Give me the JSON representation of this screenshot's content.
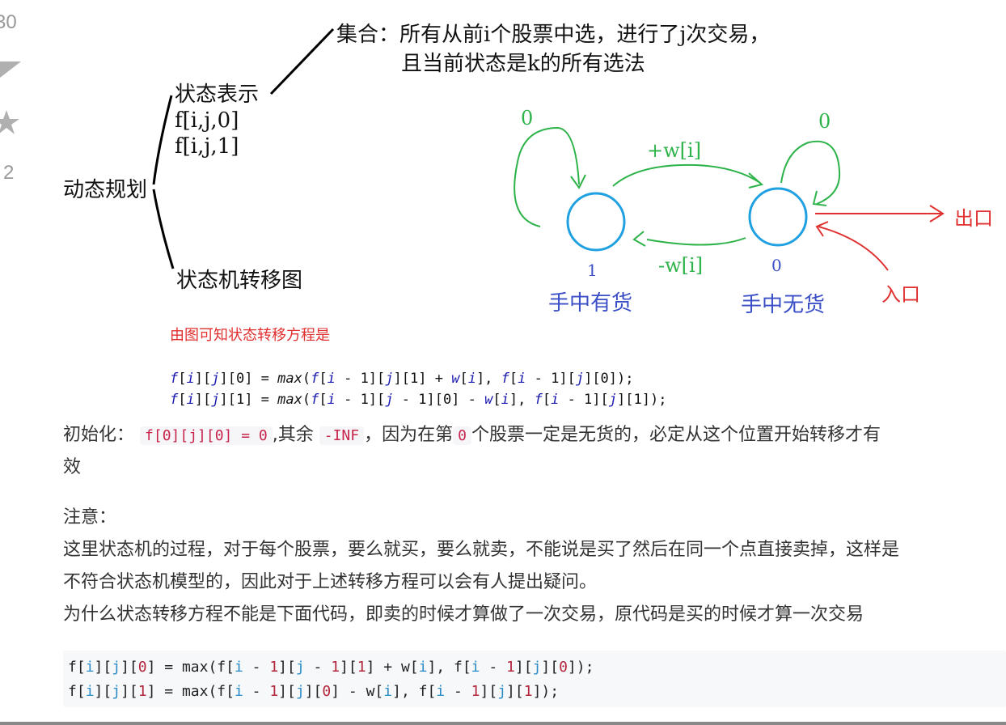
{
  "vote_panel": {
    "count_top": "30",
    "count_bottom": "2"
  },
  "diagram": {
    "set_label": "集合：所有从前i个股票中选，进行了j次交易，",
    "set_label_2": "且当前状态是k的所有选法",
    "state_repr": "状态表示",
    "state_f0": "f[i,j,0]",
    "state_f1": "f[i,j,1]",
    "dp": "动态规划",
    "state_machine": "状态机转移图",
    "loop_left": "0",
    "loop_right": "0",
    "edge_top": "+w[i]",
    "edge_bottom": "-w[i]",
    "node_left_num": "1",
    "node_right_num": "0",
    "node_left_label": "手中有货",
    "node_right_label": "手中无货",
    "exit": "出口",
    "entry": "入口",
    "conclusion": "由图可知状态转移方程是",
    "colors": {
      "green": "#2db34a",
      "blue": "#3a4fc7",
      "red": "#e03030",
      "circle": "#1fa0e0"
    }
  },
  "equations": {
    "line1": {
      "f": "f",
      "a": "[",
      "i": "i",
      "b": "][",
      "j": "j",
      "c": "][0] = ",
      "max": "max",
      "d": "(",
      "f2": "f",
      "e": "[",
      "i2": "i",
      "g": " - 1][",
      "j2": "j",
      "h": "][1] + ",
      "w": "w",
      "k": "[",
      "i3": "i",
      "l": "], ",
      "f3": "f",
      "m": "[",
      "i4": "i",
      "n": " - 1][",
      "j3": "j",
      "o": "][0]);"
    },
    "line2": {
      "f": "f",
      "a": "[",
      "i": "i",
      "b": "][",
      "j": "j",
      "c": "][1] = ",
      "max": "max",
      "d": "(",
      "f2": "f",
      "e": "[",
      "i2": "i",
      "g": " - 1][",
      "j2": "j",
      "h": " - 1][0] - ",
      "w": "w",
      "k": "[",
      "i3": "i",
      "l": "], ",
      "f3": "f",
      "m": "[",
      "i4": "i",
      "n": " - 1][",
      "j3": "j",
      "o": "][1]);"
    }
  },
  "article": {
    "init_prefix": "初始化：",
    "init_code": "f[0][j][0] = 0",
    "init_mid": ",其余",
    "init_inf": "-INF",
    "init_text": "，因为在第",
    "init_zero": "0",
    "init_rest": "个股票一定是无货的，必定从这个位置开始转移才有",
    "init_wrap": "效",
    "note_title": "注意：",
    "note_l1": "这里状态机的过程，对于每个股票，要么就买，要么就卖，不能说是买了然后在同一个点直接卖掉，这样是",
    "note_l2": "不符合状态机模型的，因此对于上述转移方程可以会有人提出疑问。",
    "note_l3": "为什么状态转移方程不能是下面代码，即卖的时候才算做了一次交易，原代码是买的时候才算一次交易"
  },
  "codeblock": {
    "line1": [
      "f[",
      "i",
      "][",
      "j",
      "][",
      "0",
      "] = max(f[",
      "i",
      " - ",
      "1",
      "][",
      "j",
      " - ",
      "1",
      "][",
      "1",
      "] + w[",
      "i",
      "], f[",
      "i",
      " - ",
      "1",
      "][",
      "j",
      "][",
      "0",
      "]);"
    ],
    "line2": [
      "f[",
      "i",
      "][",
      "j",
      "][",
      "1",
      "] = max(f[",
      "i",
      " - ",
      "1",
      "][",
      "j",
      "][",
      "0",
      "] - w[",
      "i",
      "], f[",
      "i",
      " - ",
      "1",
      "][",
      "j",
      "][",
      "1",
      "]);"
    ]
  }
}
